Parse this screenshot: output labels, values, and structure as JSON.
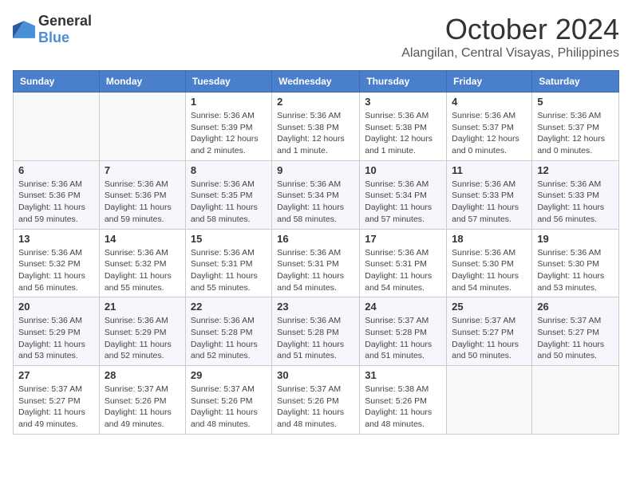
{
  "header": {
    "logo_general": "General",
    "logo_blue": "Blue",
    "month_title": "October 2024",
    "location": "Alangilan, Central Visayas, Philippines"
  },
  "days_of_week": [
    "Sunday",
    "Monday",
    "Tuesday",
    "Wednesday",
    "Thursday",
    "Friday",
    "Saturday"
  ],
  "weeks": [
    [
      {
        "day": "",
        "info": ""
      },
      {
        "day": "",
        "info": ""
      },
      {
        "day": "1",
        "info": "Sunrise: 5:36 AM\nSunset: 5:39 PM\nDaylight: 12 hours and 2 minutes."
      },
      {
        "day": "2",
        "info": "Sunrise: 5:36 AM\nSunset: 5:38 PM\nDaylight: 12 hours and 1 minute."
      },
      {
        "day": "3",
        "info": "Sunrise: 5:36 AM\nSunset: 5:38 PM\nDaylight: 12 hours and 1 minute."
      },
      {
        "day": "4",
        "info": "Sunrise: 5:36 AM\nSunset: 5:37 PM\nDaylight: 12 hours and 0 minutes."
      },
      {
        "day": "5",
        "info": "Sunrise: 5:36 AM\nSunset: 5:37 PM\nDaylight: 12 hours and 0 minutes."
      }
    ],
    [
      {
        "day": "6",
        "info": "Sunrise: 5:36 AM\nSunset: 5:36 PM\nDaylight: 11 hours and 59 minutes."
      },
      {
        "day": "7",
        "info": "Sunrise: 5:36 AM\nSunset: 5:36 PM\nDaylight: 11 hours and 59 minutes."
      },
      {
        "day": "8",
        "info": "Sunrise: 5:36 AM\nSunset: 5:35 PM\nDaylight: 11 hours and 58 minutes."
      },
      {
        "day": "9",
        "info": "Sunrise: 5:36 AM\nSunset: 5:34 PM\nDaylight: 11 hours and 58 minutes."
      },
      {
        "day": "10",
        "info": "Sunrise: 5:36 AM\nSunset: 5:34 PM\nDaylight: 11 hours and 57 minutes."
      },
      {
        "day": "11",
        "info": "Sunrise: 5:36 AM\nSunset: 5:33 PM\nDaylight: 11 hours and 57 minutes."
      },
      {
        "day": "12",
        "info": "Sunrise: 5:36 AM\nSunset: 5:33 PM\nDaylight: 11 hours and 56 minutes."
      }
    ],
    [
      {
        "day": "13",
        "info": "Sunrise: 5:36 AM\nSunset: 5:32 PM\nDaylight: 11 hours and 56 minutes."
      },
      {
        "day": "14",
        "info": "Sunrise: 5:36 AM\nSunset: 5:32 PM\nDaylight: 11 hours and 55 minutes."
      },
      {
        "day": "15",
        "info": "Sunrise: 5:36 AM\nSunset: 5:31 PM\nDaylight: 11 hours and 55 minutes."
      },
      {
        "day": "16",
        "info": "Sunrise: 5:36 AM\nSunset: 5:31 PM\nDaylight: 11 hours and 54 minutes."
      },
      {
        "day": "17",
        "info": "Sunrise: 5:36 AM\nSunset: 5:31 PM\nDaylight: 11 hours and 54 minutes."
      },
      {
        "day": "18",
        "info": "Sunrise: 5:36 AM\nSunset: 5:30 PM\nDaylight: 11 hours and 54 minutes."
      },
      {
        "day": "19",
        "info": "Sunrise: 5:36 AM\nSunset: 5:30 PM\nDaylight: 11 hours and 53 minutes."
      }
    ],
    [
      {
        "day": "20",
        "info": "Sunrise: 5:36 AM\nSunset: 5:29 PM\nDaylight: 11 hours and 53 minutes."
      },
      {
        "day": "21",
        "info": "Sunrise: 5:36 AM\nSunset: 5:29 PM\nDaylight: 11 hours and 52 minutes."
      },
      {
        "day": "22",
        "info": "Sunrise: 5:36 AM\nSunset: 5:28 PM\nDaylight: 11 hours and 52 minutes."
      },
      {
        "day": "23",
        "info": "Sunrise: 5:36 AM\nSunset: 5:28 PM\nDaylight: 11 hours and 51 minutes."
      },
      {
        "day": "24",
        "info": "Sunrise: 5:37 AM\nSunset: 5:28 PM\nDaylight: 11 hours and 51 minutes."
      },
      {
        "day": "25",
        "info": "Sunrise: 5:37 AM\nSunset: 5:27 PM\nDaylight: 11 hours and 50 minutes."
      },
      {
        "day": "26",
        "info": "Sunrise: 5:37 AM\nSunset: 5:27 PM\nDaylight: 11 hours and 50 minutes."
      }
    ],
    [
      {
        "day": "27",
        "info": "Sunrise: 5:37 AM\nSunset: 5:27 PM\nDaylight: 11 hours and 49 minutes."
      },
      {
        "day": "28",
        "info": "Sunrise: 5:37 AM\nSunset: 5:26 PM\nDaylight: 11 hours and 49 minutes."
      },
      {
        "day": "29",
        "info": "Sunrise: 5:37 AM\nSunset: 5:26 PM\nDaylight: 11 hours and 48 minutes."
      },
      {
        "day": "30",
        "info": "Sunrise: 5:37 AM\nSunset: 5:26 PM\nDaylight: 11 hours and 48 minutes."
      },
      {
        "day": "31",
        "info": "Sunrise: 5:38 AM\nSunset: 5:26 PM\nDaylight: 11 hours and 48 minutes."
      },
      {
        "day": "",
        "info": ""
      },
      {
        "day": "",
        "info": ""
      }
    ]
  ]
}
